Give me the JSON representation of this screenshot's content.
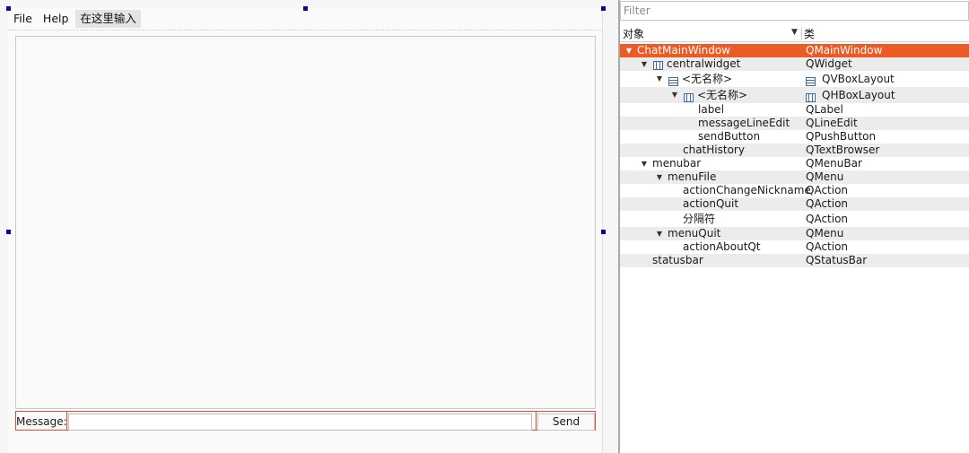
{
  "menubar": {
    "items": [
      {
        "label": "File"
      },
      {
        "label": "Help"
      }
    ],
    "type_here": "在这里输入"
  },
  "form": {
    "message_label": "Message:",
    "message_value": "",
    "send_label": "Send"
  },
  "inspector": {
    "filter_placeholder": "Filter",
    "col_object": "对象",
    "col_class": "类",
    "tree": [
      {
        "name": "ChatMainWindow",
        "class": "QMainWindow",
        "level": 0,
        "expanded": true,
        "selected": true,
        "icon": "none",
        "class_icon": "none"
      },
      {
        "name": "centralwidget",
        "class": "QWidget",
        "level": 1,
        "expanded": true,
        "icon": "hbox-layout-icon",
        "class_icon": "none"
      },
      {
        "name": "<无名称>",
        "class": "QVBoxLayout",
        "level": 2,
        "expanded": true,
        "icon": "vbox-layout-icon",
        "class_icon": "vbox-layout-icon"
      },
      {
        "name": "<无名称>",
        "class": "QHBoxLayout",
        "level": 3,
        "expanded": true,
        "icon": "hbox-layout-icon",
        "class_icon": "hbox-layout-icon"
      },
      {
        "name": "label",
        "class": "QLabel",
        "level": 4,
        "icon": "none",
        "class_icon": "none"
      },
      {
        "name": "messageLineEdit",
        "class": "QLineEdit",
        "level": 4,
        "icon": "none",
        "class_icon": "none"
      },
      {
        "name": "sendButton",
        "class": "QPushButton",
        "level": 4,
        "icon": "none",
        "class_icon": "none"
      },
      {
        "name": "chatHistory",
        "class": "QTextBrowser",
        "level": 3,
        "icon": "none",
        "class_icon": "none"
      },
      {
        "name": "menubar",
        "class": "QMenuBar",
        "level": 1,
        "expanded": true,
        "icon": "none",
        "class_icon": "none"
      },
      {
        "name": "menuFile",
        "class": "QMenu",
        "level": 2,
        "expanded": true,
        "icon": "none",
        "class_icon": "none"
      },
      {
        "name": "actionChangeNickname",
        "class": "QAction",
        "level": 3,
        "icon": "none",
        "class_icon": "none"
      },
      {
        "name": "actionQuit",
        "class": "QAction",
        "level": 3,
        "icon": "none",
        "class_icon": "none"
      },
      {
        "name": "分隔符",
        "class": "QAction",
        "level": 3,
        "icon": "none",
        "class_icon": "none"
      },
      {
        "name": "menuQuit",
        "class": "QMenu",
        "level": 2,
        "expanded": true,
        "icon": "none",
        "class_icon": "none"
      },
      {
        "name": "actionAboutQt",
        "class": "QAction",
        "level": 3,
        "icon": "none",
        "class_icon": "none"
      },
      {
        "name": "statusbar",
        "class": "QStatusBar",
        "level": 1,
        "icon": "none",
        "class_icon": "none"
      }
    ]
  },
  "colors": {
    "selection": "#ec5b26",
    "layout_outline": "#e24a3a",
    "handle": "#0a0a8c"
  }
}
